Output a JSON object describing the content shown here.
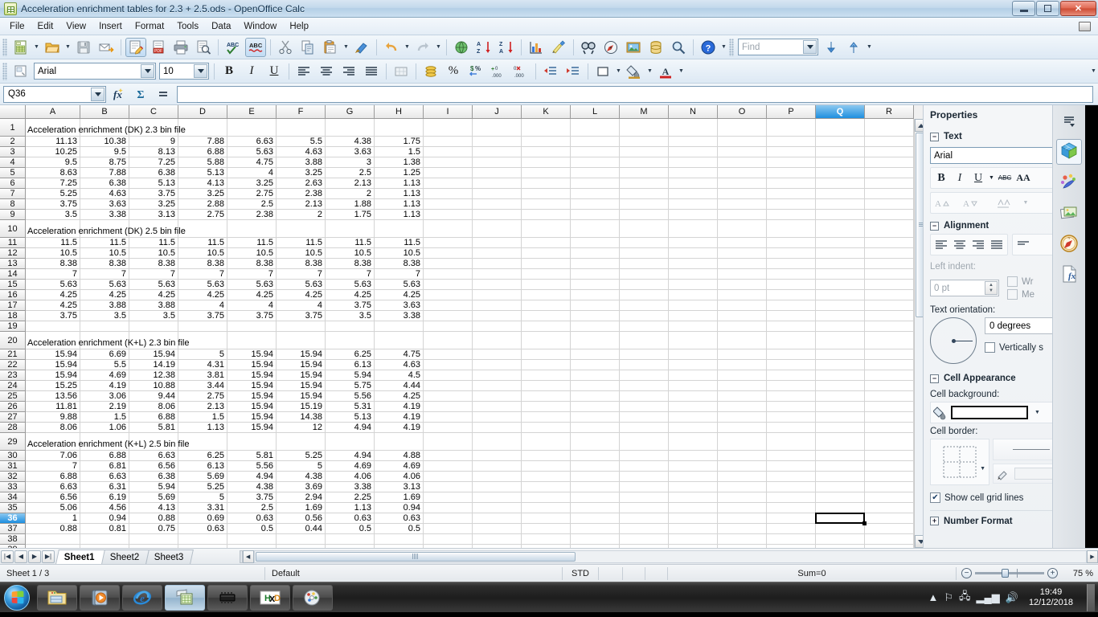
{
  "window": {
    "title": "Acceleration enrichment tables for 2.3 + 2.5.ods - OpenOffice Calc",
    "app_icon": "calc-document-icon",
    "minimize_label": "Minimize",
    "restore_label": "Restore",
    "close_label": "Close"
  },
  "menubar": {
    "items": [
      {
        "label": "File"
      },
      {
        "label": "Edit"
      },
      {
        "label": "View"
      },
      {
        "label": "Insert"
      },
      {
        "label": "Format"
      },
      {
        "label": "Tools"
      },
      {
        "label": "Data"
      },
      {
        "label": "Window"
      },
      {
        "label": "Help"
      }
    ]
  },
  "standard_toolbar": {
    "buttons": [
      {
        "name": "new-document-icon",
        "glyph": "N"
      },
      {
        "name": "open-document-icon",
        "glyph": "O"
      },
      {
        "name": "save-document-icon",
        "glyph": "S"
      },
      {
        "name": "email-document-icon",
        "glyph": "M"
      },
      {
        "name": "edit-file-icon",
        "glyph": "E"
      },
      {
        "name": "export-pdf-icon",
        "glyph": "P"
      },
      {
        "name": "print-file-icon",
        "glyph": "R"
      },
      {
        "name": "print-preview-icon",
        "glyph": "V"
      },
      {
        "name": "spelling-icon",
        "glyph": "ABC"
      },
      {
        "name": "autospellcheck-icon",
        "glyph": "ABC"
      },
      {
        "name": "cut-icon",
        "glyph": "X"
      },
      {
        "name": "copy-icon",
        "glyph": "C"
      },
      {
        "name": "paste-icon",
        "glyph": "P"
      },
      {
        "name": "clone-formatting-icon",
        "glyph": "F"
      },
      {
        "name": "undo-icon",
        "glyph": "U"
      },
      {
        "name": "redo-icon",
        "glyph": "R"
      },
      {
        "name": "hyperlink-icon",
        "glyph": "H"
      },
      {
        "name": "sort-ascending-icon",
        "glyph": "AZ"
      },
      {
        "name": "sort-descending-icon",
        "glyph": "ZA"
      },
      {
        "name": "insert-chart-icon",
        "glyph": "B"
      },
      {
        "name": "draw-functions-icon",
        "glyph": "D"
      },
      {
        "name": "find-replace-icon",
        "glyph": "FR"
      },
      {
        "name": "navigator-icon",
        "glyph": "N"
      },
      {
        "name": "insert-image-icon",
        "glyph": "I"
      },
      {
        "name": "data-sources-icon",
        "glyph": "DS"
      },
      {
        "name": "zoom-icon",
        "glyph": "Z"
      },
      {
        "name": "help-icon",
        "glyph": "?"
      }
    ],
    "find_placeholder": "Find",
    "find_value": "",
    "find_down_label": "Find Next",
    "find_up_label": "Find Previous"
  },
  "formatting_toolbar": {
    "styles_icon": "apply-style-icon",
    "font_name": "Arial",
    "font_size": "10",
    "bold_label": "B",
    "italic_label": "I",
    "underline_label": "U",
    "align_left_label": "Align Left",
    "align_center_label": "Align Center",
    "align_right_label": "Align Right",
    "align_justify_label": "Justified",
    "merge_cells_label": "Merge Cells",
    "currency_label": "Currency",
    "percent_label": "Percent",
    "number_format_label": "Number Format",
    "add_decimal_label": "Add Decimal Place",
    "delete_decimal_label": "Delete Decimal Place",
    "decrease_indent_label": "Decrease Indent",
    "increase_indent_label": "Increase Indent",
    "borders_label": "Borders",
    "background_color_label": "Background Color",
    "font_color_label": "Font Color"
  },
  "formula_bar": {
    "name_box_value": "Q36",
    "function_wizard_label": "fx",
    "sum_label": "Σ",
    "function_label": "=",
    "input_line_value": ""
  },
  "sheet": {
    "columns": [
      "A",
      "B",
      "C",
      "D",
      "E",
      "F",
      "G",
      "H",
      "I",
      "J",
      "K",
      "L",
      "M",
      "N",
      "O",
      "P",
      "Q",
      "R"
    ],
    "selected_column": "Q",
    "selected_row": 36,
    "selected_cell": "Q36",
    "rows": [
      {
        "num": 1,
        "tall": true,
        "text": "Acceleration enrichment (DK) 2.3 bin file",
        "values": []
      },
      {
        "num": 2,
        "values": [
          "11.13",
          "10.38",
          "9",
          "7.88",
          "6.63",
          "5.5",
          "4.38",
          "1.75"
        ]
      },
      {
        "num": 3,
        "values": [
          "10.25",
          "9.5",
          "8.13",
          "6.88",
          "5.63",
          "4.63",
          "3.63",
          "1.5"
        ]
      },
      {
        "num": 4,
        "values": [
          "9.5",
          "8.75",
          "7.25",
          "5.88",
          "4.75",
          "3.88",
          "3",
          "1.38"
        ]
      },
      {
        "num": 5,
        "values": [
          "8.63",
          "7.88",
          "6.38",
          "5.13",
          "4",
          "3.25",
          "2.5",
          "1.25"
        ]
      },
      {
        "num": 6,
        "values": [
          "7.25",
          "6.38",
          "5.13",
          "4.13",
          "3.25",
          "2.63",
          "2.13",
          "1.13"
        ]
      },
      {
        "num": 7,
        "values": [
          "5.25",
          "4.63",
          "3.75",
          "3.25",
          "2.75",
          "2.38",
          "2",
          "1.13"
        ]
      },
      {
        "num": 8,
        "values": [
          "3.75",
          "3.63",
          "3.25",
          "2.88",
          "2.5",
          "2.13",
          "1.88",
          "1.13"
        ]
      },
      {
        "num": 9,
        "values": [
          "3.5",
          "3.38",
          "3.13",
          "2.75",
          "2.38",
          "2",
          "1.75",
          "1.13"
        ]
      },
      {
        "num": 10,
        "tall": true,
        "text": "Acceleration enrichment (DK) 2.5 bin file",
        "values": []
      },
      {
        "num": 11,
        "values": [
          "11.5",
          "11.5",
          "11.5",
          "11.5",
          "11.5",
          "11.5",
          "11.5",
          "11.5"
        ]
      },
      {
        "num": 12,
        "values": [
          "10.5",
          "10.5",
          "10.5",
          "10.5",
          "10.5",
          "10.5",
          "10.5",
          "10.5"
        ]
      },
      {
        "num": 13,
        "values": [
          "8.38",
          "8.38",
          "8.38",
          "8.38",
          "8.38",
          "8.38",
          "8.38",
          "8.38"
        ]
      },
      {
        "num": 14,
        "values": [
          "7",
          "7",
          "7",
          "7",
          "7",
          "7",
          "7",
          "7"
        ]
      },
      {
        "num": 15,
        "values": [
          "5.63",
          "5.63",
          "5.63",
          "5.63",
          "5.63",
          "5.63",
          "5.63",
          "5.63"
        ]
      },
      {
        "num": 16,
        "values": [
          "4.25",
          "4.25",
          "4.25",
          "4.25",
          "4.25",
          "4.25",
          "4.25",
          "4.25"
        ]
      },
      {
        "num": 17,
        "values": [
          "4.25",
          "3.88",
          "3.88",
          "4",
          "4",
          "4",
          "3.75",
          "3.63"
        ]
      },
      {
        "num": 18,
        "values": [
          "3.75",
          "3.5",
          "3.5",
          "3.75",
          "3.75",
          "3.75",
          "3.5",
          "3.38"
        ]
      },
      {
        "num": 19,
        "values": []
      },
      {
        "num": 20,
        "tall": true,
        "text": "Acceleration enrichment (K+L) 2.3 bin file",
        "values": []
      },
      {
        "num": 21,
        "values": [
          "15.94",
          "6.69",
          "15.94",
          "5",
          "15.94",
          "15.94",
          "6.25",
          "4.75"
        ]
      },
      {
        "num": 22,
        "values": [
          "15.94",
          "5.5",
          "14.19",
          "4.31",
          "15.94",
          "15.94",
          "6.13",
          "4.63"
        ]
      },
      {
        "num": 23,
        "values": [
          "15.94",
          "4.69",
          "12.38",
          "3.81",
          "15.94",
          "15.94",
          "5.94",
          "4.5"
        ]
      },
      {
        "num": 24,
        "values": [
          "15.25",
          "4.19",
          "10.88",
          "3.44",
          "15.94",
          "15.94",
          "5.75",
          "4.44"
        ]
      },
      {
        "num": 25,
        "values": [
          "13.56",
          "3.06",
          "9.44",
          "2.75",
          "15.94",
          "15.94",
          "5.56",
          "4.25"
        ]
      },
      {
        "num": 26,
        "values": [
          "11.81",
          "2.19",
          "8.06",
          "2.13",
          "15.94",
          "15.19",
          "5.31",
          "4.19"
        ]
      },
      {
        "num": 27,
        "values": [
          "9.88",
          "1.5",
          "6.88",
          "1.5",
          "15.94",
          "14.38",
          "5.13",
          "4.19"
        ]
      },
      {
        "num": 28,
        "values": [
          "8.06",
          "1.06",
          "5.81",
          "1.13",
          "15.94",
          "12",
          "4.94",
          "4.19"
        ]
      },
      {
        "num": 29,
        "tall": true,
        "text": "Acceleration enrichment (K+L) 2.5 bin file",
        "values": []
      },
      {
        "num": 30,
        "values": [
          "7.06",
          "6.88",
          "6.63",
          "6.25",
          "5.81",
          "5.25",
          "4.94",
          "4.88"
        ]
      },
      {
        "num": 31,
        "values": [
          "7",
          "6.81",
          "6.56",
          "6.13",
          "5.56",
          "5",
          "4.69",
          "4.69"
        ]
      },
      {
        "num": 32,
        "values": [
          "6.88",
          "6.63",
          "6.38",
          "5.69",
          "4.94",
          "4.38",
          "4.06",
          "4.06"
        ]
      },
      {
        "num": 33,
        "values": [
          "6.63",
          "6.31",
          "5.94",
          "5.25",
          "4.38",
          "3.69",
          "3.38",
          "3.13"
        ]
      },
      {
        "num": 34,
        "values": [
          "6.56",
          "6.19",
          "5.69",
          "5",
          "3.75",
          "2.94",
          "2.25",
          "1.69"
        ]
      },
      {
        "num": 35,
        "values": [
          "5.06",
          "4.56",
          "4.13",
          "3.31",
          "2.5",
          "1.69",
          "1.13",
          "0.94"
        ]
      },
      {
        "num": 36,
        "values": [
          "1",
          "0.94",
          "0.88",
          "0.69",
          "0.63",
          "0.56",
          "0.63",
          "0.63"
        ]
      },
      {
        "num": 37,
        "values": [
          "0.88",
          "0.81",
          "0.75",
          "0.63",
          "0.5",
          "0.44",
          "0.5",
          "0.5"
        ]
      },
      {
        "num": 38,
        "values": []
      },
      {
        "num": 39,
        "values": []
      }
    ]
  },
  "sidebar": {
    "title": "Properties",
    "close_label": "×",
    "sections": {
      "text": {
        "title": "Text",
        "font_name": "Arial",
        "bold_label": "B",
        "italic_label": "I",
        "underline_label": "U",
        "strikethrough_label": "ABC",
        "shadow_label": "AA",
        "increase_size_label": "A",
        "decrease_size_label": "A",
        "spacing_label": "Character Spacing",
        "font_color_label": "A"
      },
      "alignment": {
        "title": "Alignment",
        "align_left_label": "Align Left",
        "align_center_label": "Align Center",
        "align_right_label": "Align Right",
        "align_justify_label": "Justified",
        "left_indent_label": "Left indent:",
        "left_indent_value": "0 pt",
        "wrap_label": "Wr",
        "merge_label": "Me",
        "text_orientation_label": "Text orientation:",
        "degrees_value": "0 degrees",
        "vertically_stacked_label": "Vertically s"
      },
      "cell_appearance": {
        "title": "Cell Appearance",
        "cell_background_label": "Cell background:",
        "cell_border_label": "Cell border:",
        "show_grid_label": "Show cell grid lines",
        "show_grid_checked": true
      },
      "number_format": {
        "title": "Number Format"
      }
    },
    "tabs": [
      {
        "name": "sidebar-settings-icon",
        "label": "Sidebar Settings"
      },
      {
        "name": "properties-deck-icon",
        "label": "Properties",
        "active": true
      },
      {
        "name": "styles-deck-icon",
        "label": "Styles and Formatting"
      },
      {
        "name": "gallery-deck-icon",
        "label": "Gallery"
      },
      {
        "name": "navigator-deck-icon",
        "label": "Navigator"
      },
      {
        "name": "functions-deck-icon",
        "label": "Functions"
      }
    ]
  },
  "sheet_tabs": {
    "first_label": "First Sheet",
    "prev_label": "Previous Sheet",
    "next_label": "Next Sheet",
    "last_label": "Last Sheet",
    "tabs": [
      {
        "label": "Sheet1",
        "active": true
      },
      {
        "label": "Sheet2",
        "active": false
      },
      {
        "label": "Sheet3",
        "active": false
      }
    ]
  },
  "status_bar": {
    "sheet_info": "Sheet 1 / 3",
    "page_style": "Default",
    "insert_mode": "STD",
    "selection_mode": "",
    "modified": "",
    "signature": "",
    "sum": "Sum=0",
    "zoom_percent": "75 %"
  },
  "taskbar": {
    "start_label": "Start",
    "items": [
      {
        "name": "taskbar-explorer-icon",
        "label": "Windows Explorer"
      },
      {
        "name": "taskbar-media-player-icon",
        "label": "Windows Media Player"
      },
      {
        "name": "taskbar-internet-explorer-icon",
        "label": "Internet Explorer"
      },
      {
        "name": "taskbar-openoffice-calc-icon",
        "label": "OpenOffice Calc",
        "active": true
      },
      {
        "name": "taskbar-chip-icon",
        "label": "TunerStudio"
      },
      {
        "name": "taskbar-hxd-icon",
        "label": "HxD Hex Editor"
      },
      {
        "name": "taskbar-paint-icon",
        "label": "Paint"
      }
    ],
    "tray": {
      "show_hidden_label": "Show hidden icons",
      "action_center_icon": "flag-icon",
      "network_icon": "network-icon",
      "signal_icon": "signal-icon",
      "volume_icon": "volume-icon",
      "time": "19:49",
      "date": "12/12/2018"
    }
  }
}
